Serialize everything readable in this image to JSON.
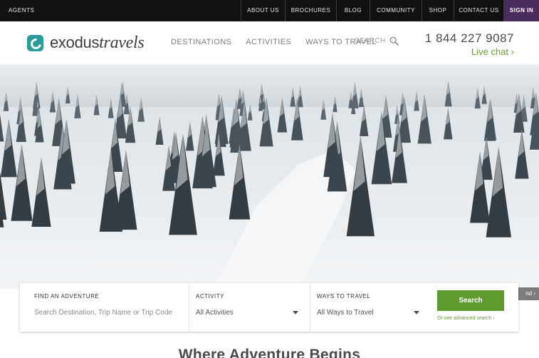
{
  "topbar": {
    "agents_label": "AGENTS",
    "nav": [
      {
        "label": "ABOUT US"
      },
      {
        "label": "BROCHURES"
      },
      {
        "label": "BLOG"
      },
      {
        "label": "COMMUNITY"
      },
      {
        "label": "SHOP"
      },
      {
        "label": "CONTACT US"
      },
      {
        "label": "SIGN IN"
      }
    ]
  },
  "header": {
    "logo_text_bold": "exodus",
    "logo_text_italic": "travels",
    "nav": [
      {
        "label": "DESTINATIONS"
      },
      {
        "label": "ACTIVITIES"
      },
      {
        "label": "WAYS TO TRAVEL"
      }
    ],
    "search_label": "SEARCH",
    "search_icon": "search-icon",
    "phone": "1 844 227 9087",
    "live_chat": "Live chat ›"
  },
  "hero": {
    "expand_label": "nd ›"
  },
  "search_panel": {
    "adventure_label": "FIND AN ADVENTURE",
    "adventure_placeholder": "Search Destination, Trip Name or Trip Code",
    "activity_label": "ACTIVITY",
    "activity_value": "All Activities",
    "ways_label": "WAYS TO TRAVEL",
    "ways_value": "All Ways to Travel",
    "search_button": "Search",
    "advanced_link": "Or see advanced search ›"
  },
  "main": {
    "heading": "Where Adventure Begins"
  },
  "colors": {
    "topbar_bg": "#111111",
    "signin_bg": "#4b2c5e",
    "brand_teal": "#2a9d9a",
    "accent_green": "#5f9a31"
  }
}
